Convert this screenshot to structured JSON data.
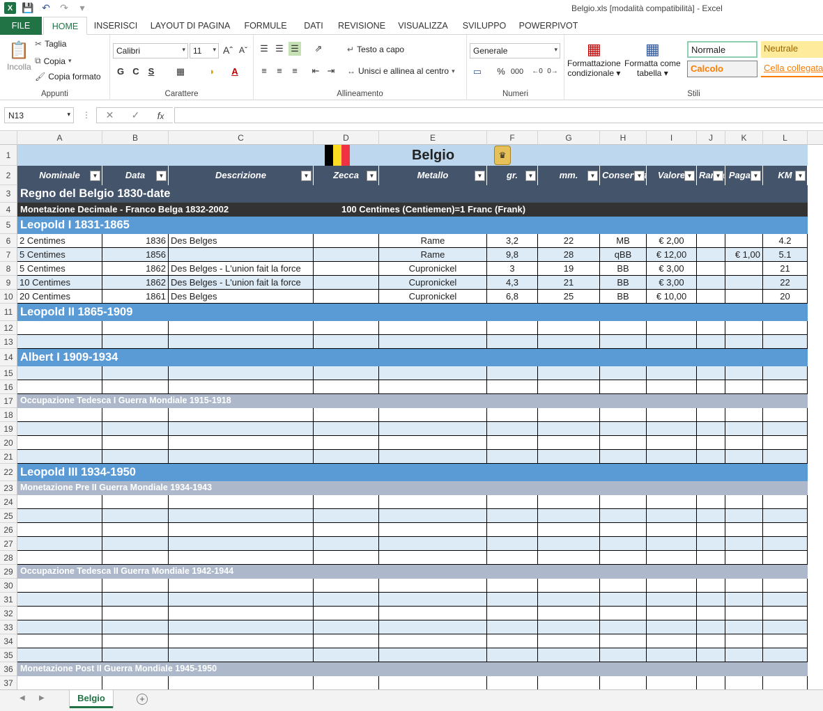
{
  "titlebar": {
    "title": "Belgio.xls  [modalità compatibilità] - Excel"
  },
  "ribbon_tabs": [
    "FILE",
    "HOME",
    "INSERISCI",
    "LAYOUT DI PAGINA",
    "FORMULE",
    "DATI",
    "REVISIONE",
    "VISUALIZZA",
    "SVILUPPO",
    "POWERPIVOT"
  ],
  "clipboard": {
    "paste": "Incolla",
    "cut": "Taglia",
    "copy": "Copia",
    "format_painter": "Copia formato",
    "label": "Appunti"
  },
  "font": {
    "name": "Calibri",
    "size": "11",
    "bold": "G",
    "italic": "C",
    "underline": "S",
    "label": "Carattere"
  },
  "alignment": {
    "wrap": "Testo a capo",
    "merge": "Unisci e allinea al centro",
    "label": "Allineamento"
  },
  "number": {
    "format": "Generale",
    "percent": "%",
    "thousands": "000",
    "label": "Numeri"
  },
  "styles": {
    "conditional": [
      "Formattazione",
      "condizionale"
    ],
    "table": [
      "Formatta come",
      "tabella"
    ],
    "normal": "Normale",
    "neutral": "Neutrale",
    "calc": "Calcolo",
    "linked": "Cella collegata",
    "label": "Stili"
  },
  "formula_bar": {
    "name_box": "N13",
    "value": ""
  },
  "columns": [
    "A",
    "B",
    "C",
    "D",
    "E",
    "F",
    "G",
    "H",
    "I",
    "J",
    "K",
    "L"
  ],
  "sheet": {
    "title": "Belgio",
    "headers": [
      "Nominale",
      "Data",
      "Descrizione",
      "Zecca",
      "Metallo",
      "gr.",
      "mm.",
      "Conservazione",
      "Valore",
      "Rarità",
      "Pagato",
      "KM"
    ],
    "reign_title": "Regno del Belgio 1830-date",
    "monetazione": "Monetazione Decimale - Franco Belga 1832-2002",
    "exchange": "100 Centimes (Centiemen)=1 Franc (Frank)",
    "leopold1": "Leopold I 1831-1865",
    "coins": [
      {
        "nominale": "2 Centimes",
        "data": "1836",
        "descr": "Des Belges",
        "zecca": "",
        "metallo": "Rame",
        "gr": "3,2",
        "mm": "22",
        "cons": "MB",
        "valore": "€ 2,00",
        "rarita": "",
        "pagato": "",
        "km": "4.2"
      },
      {
        "nominale": "5 Centimes",
        "data": "1856",
        "descr": "",
        "zecca": "",
        "metallo": "Rame",
        "gr": "9,8",
        "mm": "28",
        "cons": "qBB",
        "valore": "€ 12,00",
        "rarita": "",
        "pagato": "€ 1,00",
        "km": "5.1"
      },
      {
        "nominale": "5 Centimes",
        "data": "1862",
        "descr": "Des Belges - L'union fait la force",
        "zecca": "",
        "metallo": "Cupronickel",
        "gr": "3",
        "mm": "19",
        "cons": "BB",
        "valore": "€ 3,00",
        "rarita": "",
        "pagato": "",
        "km": "21"
      },
      {
        "nominale": "10 Centimes",
        "data": "1862",
        "descr": "Des Belges - L'union fait la force",
        "zecca": "",
        "metallo": "Cupronickel",
        "gr": "4,3",
        "mm": "21",
        "cons": "BB",
        "valore": "€ 3,00",
        "rarita": "",
        "pagato": "",
        "km": "22"
      },
      {
        "nominale": "20 Centimes",
        "data": "1861",
        "descr": "Des Belges",
        "zecca": "",
        "metallo": "Cupronickel",
        "gr": "6,8",
        "mm": "25",
        "cons": "BB",
        "valore": "€ 10,00",
        "rarita": "",
        "pagato": "",
        "km": "20"
      }
    ],
    "leopold2": "Leopold II 1865-1909",
    "albert1": "Albert I 1909-1934",
    "occ1": "Occupazione Tedesca I Guerra Mondiale 1915-1918",
    "leopold3": "Leopold III 1934-1950",
    "pre2": "Monetazione Pre II Guerra Mondiale 1934-1943",
    "occ2": "Occupazione Tedesca II Guerra Mondiale 1942-1944",
    "post2": "Monetazione Post II Guerra Mondiale 1945-1950"
  },
  "row_numbers": [
    "1",
    "2",
    "3",
    "4",
    "5",
    "6",
    "7",
    "8",
    "9",
    "10",
    "11",
    "12",
    "13",
    "14",
    "15",
    "16",
    "17",
    "18",
    "19",
    "20",
    "21",
    "22",
    "23",
    "24",
    "25",
    "26",
    "27",
    "28",
    "29",
    "30",
    "31",
    "32",
    "33",
    "34",
    "35",
    "36",
    "37"
  ],
  "sheet_tab": "Belgio",
  "colors": {
    "excel_green": "#217346",
    "header_band": "#44546a",
    "ruler_band": "#5b9bd5",
    "sub_band": "#adb9ca",
    "alt_row": "#ddebf7"
  }
}
